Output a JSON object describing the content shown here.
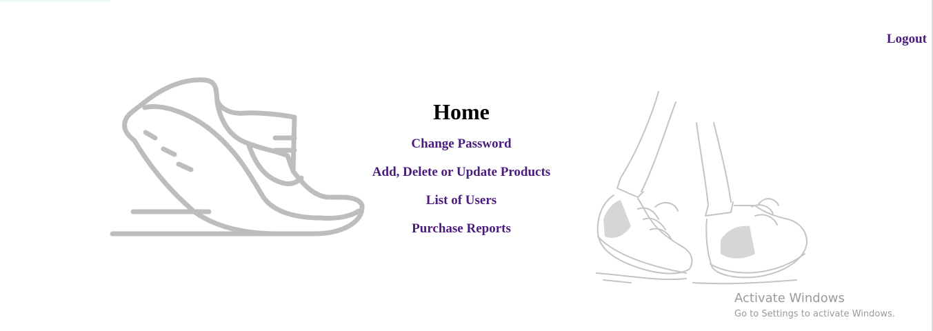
{
  "header": {
    "logout_label": "Logout"
  },
  "main": {
    "title": "Home",
    "links": [
      {
        "label": "Change Password"
      },
      {
        "label": "Add, Delete or Update Products"
      },
      {
        "label": "List of Users"
      },
      {
        "label": "Purchase Reports"
      }
    ]
  },
  "illustrations": {
    "left": "running-shoe-icon",
    "right": "walking-sneakers-illustration"
  },
  "watermark": {
    "title": "Activate Windows",
    "subtitle": "Go to Settings to activate Windows."
  },
  "colors": {
    "link": "#4b1a7d",
    "title": "#000000",
    "illustration": "#bdbdbd",
    "watermark": "#9a9a9a"
  }
}
